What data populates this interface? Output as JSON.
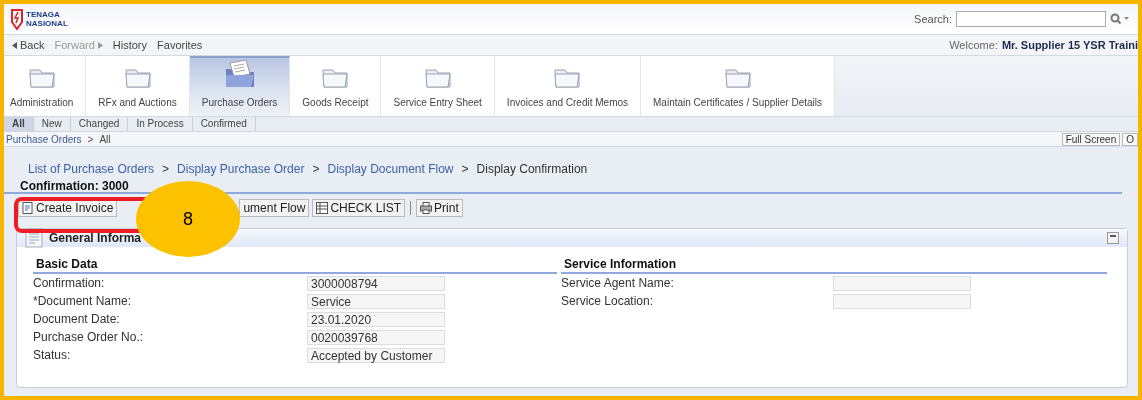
{
  "header": {
    "logo_text": [
      "TENAGA",
      "NASIONAL"
    ],
    "search": {
      "label": "Search:"
    }
  },
  "nav": {
    "back": "Back",
    "forward": {
      "label": "Forward",
      "disabled": true
    },
    "links": [
      "History",
      "Favorites"
    ],
    "welcome_label": "Welcome:",
    "user": "Mr. Supplier 15 YSR Traini"
  },
  "tabs": [
    {
      "label": "Administration",
      "selected": false
    },
    {
      "label": "RFx and Auctions",
      "selected": false
    },
    {
      "label": "Purchase Orders",
      "selected": true
    },
    {
      "label": "Goods Receipt",
      "selected": false
    },
    {
      "label": "Service Entry Sheet",
      "selected": false
    },
    {
      "label": "Invoices and Credit Memos",
      "selected": false
    },
    {
      "label": "Maintain Certificates / Supplier Details",
      "selected": false
    }
  ],
  "subtabs": [
    {
      "label": "All",
      "selected": true
    },
    {
      "label": "New",
      "selected": false
    },
    {
      "label": "Changed",
      "selected": false
    },
    {
      "label": "In Process",
      "selected": false
    },
    {
      "label": "Confirmed",
      "selected": false
    }
  ],
  "path": {
    "items": [
      "Purchase Orders",
      "All"
    ],
    "separator": ">",
    "buttons": [
      "Full Screen",
      "O"
    ]
  },
  "breadcrumb_separator": ">",
  "breadcrumbs": [
    {
      "label": "List of Purchase Orders",
      "link": true
    },
    {
      "label": "Display Purchase Order",
      "link": true
    },
    {
      "label": "Display Document Flow",
      "link": true
    },
    {
      "label": "Display Confirmation",
      "link": false
    }
  ],
  "page_title": "Confirmation: 3000",
  "toolbar": [
    {
      "label": "Create Invoice",
      "kind": "invoice"
    },
    {
      "label": "ument Flow",
      "kind": "flow"
    },
    {
      "label": "CHECK LIST",
      "kind": "list"
    },
    {
      "label": "Print",
      "kind": "print"
    }
  ],
  "panel": {
    "title": "General Informa",
    "sections": [
      {
        "title": "Basic Data",
        "fields": [
          {
            "label": "Confirmation:",
            "value": "3000008794"
          },
          {
            "label": "*Document Name:",
            "value": "Service"
          },
          {
            "label": "Document Date:",
            "value": "23.01.2020"
          },
          {
            "label": "Purchase Order No.:",
            "value": "0020039768"
          },
          {
            "label": "Status:",
            "value": "Accepted by Customer"
          }
        ]
      },
      {
        "title": "Service Information",
        "fields": [
          {
            "label": "Service Agent Name:"
          },
          {
            "label": "Service Location:"
          }
        ]
      }
    ]
  },
  "annotation": {
    "label": "8"
  }
}
